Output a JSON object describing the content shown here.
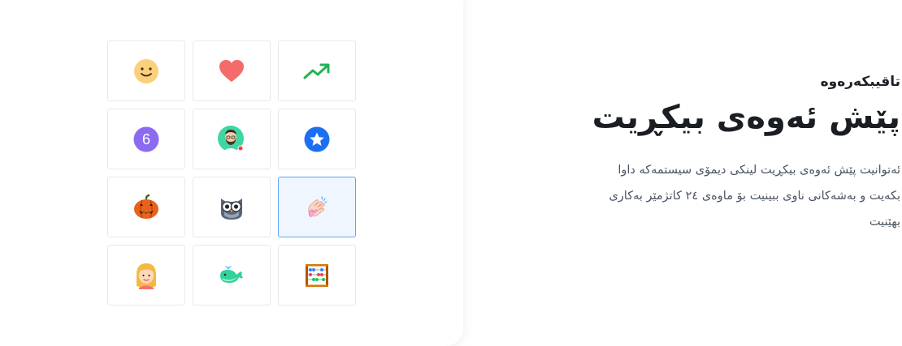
{
  "feature": {
    "eyebrow": "تاقیبکەرەوە",
    "title": "پێش ئەوەی بیکڕیت",
    "description": "ئەتوانیت پێش ئەوەی بیکڕیت لینکی دیمۆی سیستمەکە داوا بکەیت و بەشەکانی ناوی ببینیت بۆ ماوەی ٢٤ کاتژمێر بەکاری بهێنیت"
  },
  "icon_grid": {
    "selected_tile": "clapping-hands",
    "tiles": [
      {
        "name": "smiley-face",
        "color": "#fcd34d"
      },
      {
        "name": "heart",
        "color": "#f87171"
      },
      {
        "name": "trending-up",
        "color": "#22c55e"
      },
      {
        "name": "number-badge",
        "color": "#8b5cf6",
        "text": "6"
      },
      {
        "name": "bearded-avatar",
        "color": "#34d399"
      },
      {
        "name": "star-badge",
        "color": "#1d6ff2"
      },
      {
        "name": "pumpkin",
        "color": "#ea580c"
      },
      {
        "name": "owl",
        "color": "#475569"
      },
      {
        "name": "clapping-hands",
        "color": "#fcd5c3"
      },
      {
        "name": "woman-avatar",
        "color": "#fbbf24"
      },
      {
        "name": "whale",
        "color": "#34d399"
      },
      {
        "name": "abacus",
        "color": "#b45309"
      }
    ]
  },
  "colors": {
    "tile_border": "#e6e8eb",
    "selected_border": "#60a5fa",
    "selected_background": "#eff6ff",
    "heading_text": "#1a1d21",
    "body_text": "#4b5563"
  }
}
